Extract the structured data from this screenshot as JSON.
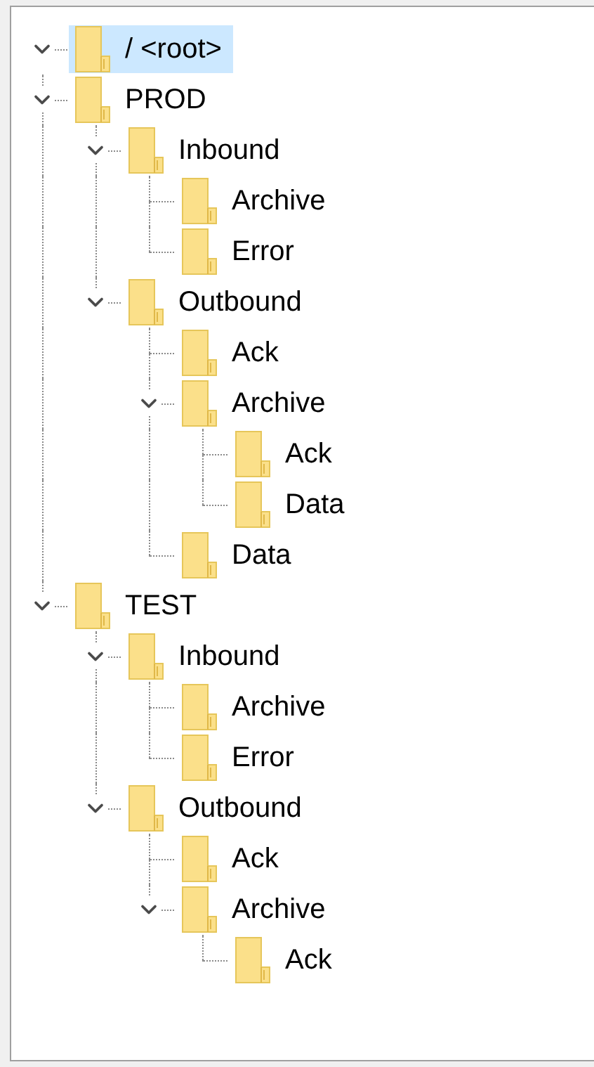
{
  "tree": [
    {
      "label": "/ <root>",
      "selected": true,
      "expanded": true,
      "children": [
        {
          "label": "PROD",
          "selected": false,
          "expanded": true,
          "children": [
            {
              "label": "Inbound",
              "selected": false,
              "expanded": true,
              "children": [
                {
                  "label": "Archive",
                  "selected": false
                },
                {
                  "label": "Error",
                  "selected": false
                }
              ]
            },
            {
              "label": "Outbound",
              "selected": false,
              "expanded": true,
              "children": [
                {
                  "label": "Ack",
                  "selected": false
                },
                {
                  "label": "Archive",
                  "selected": false,
                  "expanded": true,
                  "children": [
                    {
                      "label": "Ack",
                      "selected": false
                    },
                    {
                      "label": "Data",
                      "selected": false
                    }
                  ]
                },
                {
                  "label": "Data",
                  "selected": false
                }
              ]
            }
          ]
        },
        {
          "label": "TEST",
          "selected": false,
          "expanded": true,
          "children": [
            {
              "label": "Inbound",
              "selected": false,
              "expanded": true,
              "children": [
                {
                  "label": "Archive",
                  "selected": false
                },
                {
                  "label": "Error",
                  "selected": false
                }
              ]
            },
            {
              "label": "Outbound",
              "selected": false,
              "expanded": true,
              "children": [
                {
                  "label": "Ack",
                  "selected": false
                },
                {
                  "label": "Archive",
                  "selected": false,
                  "expanded": true,
                  "children": [
                    {
                      "label": "Ack",
                      "selected": false
                    }
                  ]
                }
              ]
            }
          ]
        }
      ]
    }
  ]
}
